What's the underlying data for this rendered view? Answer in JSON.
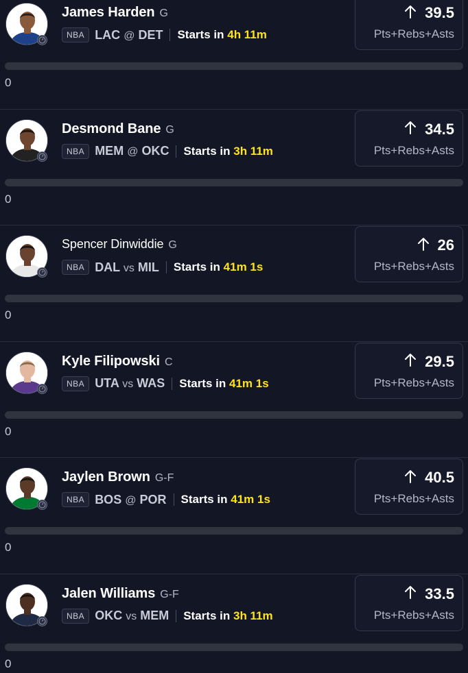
{
  "projections": [
    {
      "player": "James Harden",
      "position": "G",
      "league": "NBA",
      "team": "LAC",
      "separator": "@",
      "opponent": "DET",
      "starts_prefix": "Starts in",
      "countdown": "4h 11m",
      "line": "39.5",
      "direction": "up",
      "stat": "Pts+Rebs+Asts",
      "progress": 0,
      "count": "0",
      "jersey_color": "#1d428a",
      "skin": "#8a5a3c",
      "hair": "#2a1d16"
    },
    {
      "player": "Desmond Bane",
      "position": "G",
      "league": "NBA",
      "team": "MEM",
      "separator": "@",
      "opponent": "OKC",
      "starts_prefix": "Starts in",
      "countdown": "3h 11m",
      "line": "34.5",
      "direction": "up",
      "stat": "Pts+Rebs+Asts",
      "progress": 0,
      "count": "0",
      "jersey_color": "#222222",
      "skin": "#6e4630",
      "hair": "#1a1411"
    },
    {
      "player": "Spencer Dinwiddie",
      "position": "G",
      "league": "NBA",
      "team": "DAL",
      "separator": "vs",
      "opponent": "MIL",
      "starts_prefix": "Starts in",
      "countdown": "41m 1s",
      "line": "26",
      "direction": "up",
      "stat": "Pts+Rebs+Asts",
      "progress": 0,
      "count": "0",
      "jersey_color": "#e8e8e8",
      "skin": "#6a4330",
      "hair": "#1a1411"
    },
    {
      "player": "Kyle Filipowski",
      "position": "C",
      "league": "NBA",
      "team": "UTA",
      "separator": "vs",
      "opponent": "WAS",
      "starts_prefix": "Starts in",
      "countdown": "41m 1s",
      "line": "29.5",
      "direction": "up",
      "stat": "Pts+Rebs+Asts",
      "progress": 0,
      "count": "0",
      "jersey_color": "#5b3a8e",
      "skin": "#e4b8a0",
      "hair": "#8a6a4a"
    },
    {
      "player": "Jaylen Brown",
      "position": "G-F",
      "league": "NBA",
      "team": "BOS",
      "separator": "@",
      "opponent": "POR",
      "starts_prefix": "Starts in",
      "countdown": "41m 1s",
      "line": "40.5",
      "direction": "up",
      "stat": "Pts+Rebs+Asts",
      "progress": 0,
      "count": "0",
      "jersey_color": "#007a33",
      "skin": "#5c3a28",
      "hair": "#1a1411"
    },
    {
      "player": "Jalen Williams",
      "position": "G-F",
      "league": "NBA",
      "team": "OKC",
      "separator": "vs",
      "opponent": "MEM",
      "starts_prefix": "Starts in",
      "countdown": "3h 11m",
      "line": "33.5",
      "direction": "up",
      "stat": "Pts+Rebs+Asts",
      "progress": 0,
      "count": "0",
      "jersey_color": "#1f2a44",
      "skin": "#4e3022",
      "hair": "#1a1411"
    }
  ],
  "colors": {
    "background": "#131625",
    "countdown": "#ffe419",
    "card_border": "#343849"
  },
  "icons": {
    "direction": "arrow-up-icon",
    "badge": "clock-icon"
  }
}
